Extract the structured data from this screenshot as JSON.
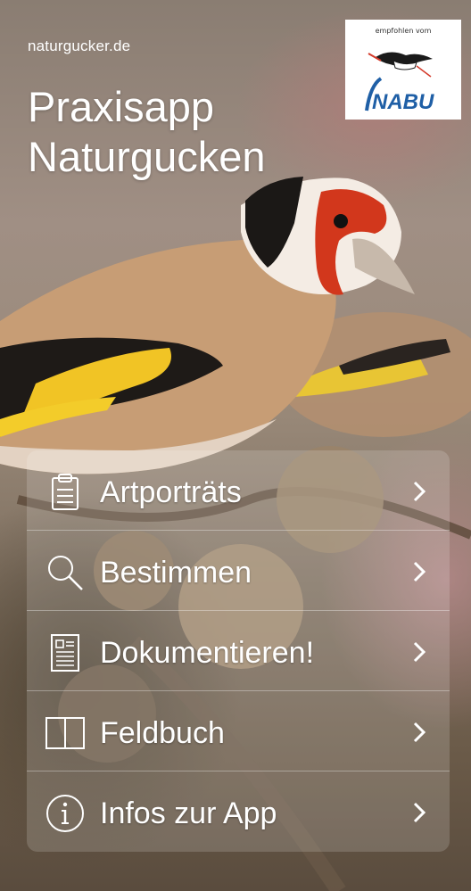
{
  "header": {
    "site_label": "naturgucker.de",
    "title_line1": "Praxisapp",
    "title_line2": "Naturgucken"
  },
  "badge": {
    "caption": "empfohlen vom",
    "logo_text": "NABU",
    "brand_color": "#1f5fa6"
  },
  "menu": {
    "items": [
      {
        "label": "Artporträts",
        "icon": "clipboard-icon"
      },
      {
        "label": "Bestimmen",
        "icon": "magnifier-icon"
      },
      {
        "label": "Dokumentieren!",
        "icon": "document-icon"
      },
      {
        "label": "Feldbuch",
        "icon": "book-icon"
      },
      {
        "label": "Infos zur App",
        "icon": "info-icon"
      }
    ]
  },
  "background": {
    "image": "goldfinch-on-burdock-photo"
  }
}
